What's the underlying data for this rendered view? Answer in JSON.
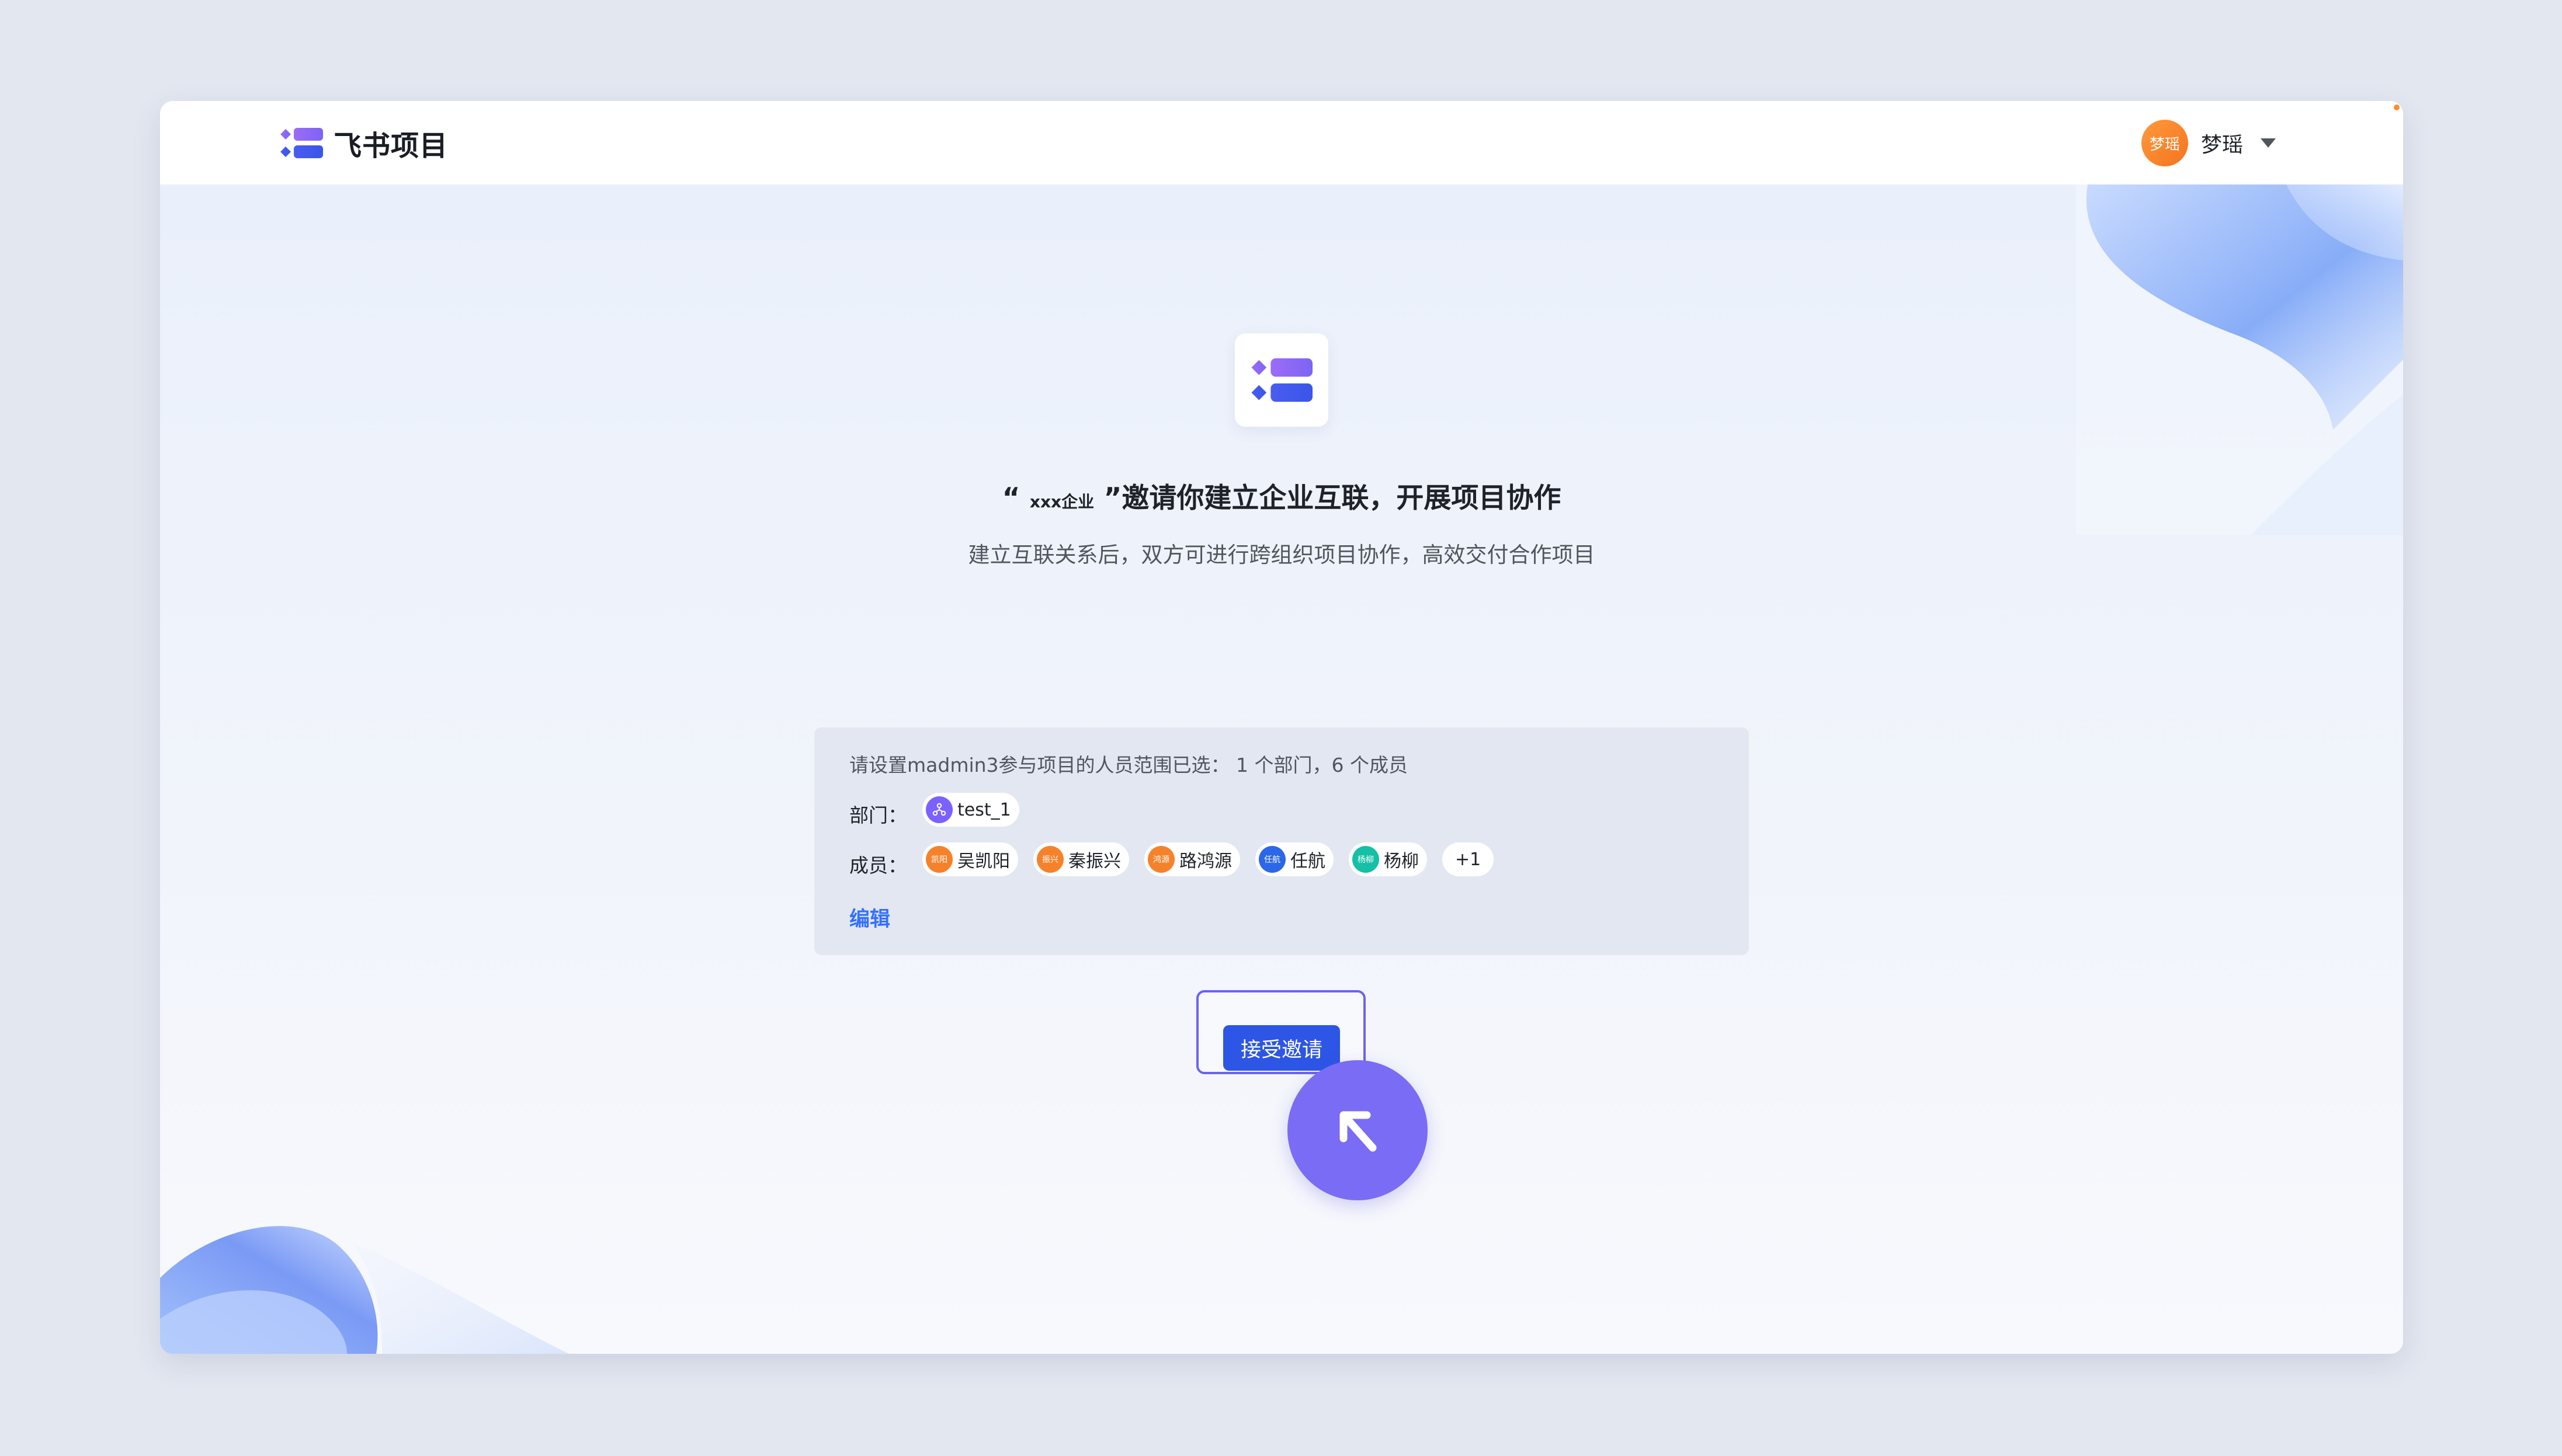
{
  "app": {
    "brand_name": "飞书项目"
  },
  "header": {
    "user_avatar_text": "梦瑶",
    "user_name": "梦瑶"
  },
  "invite": {
    "quote_open": "“",
    "org_name": "xxx企业",
    "quote_close": "”",
    "title_text": "邀请你建立企业互联，开展项目协作",
    "subtitle": "建立互联关系后，双方可进行跨组织项目协作，高效交付合作项目"
  },
  "range": {
    "hint": "请设置madmin3参与项目的人员范围已选：  1 个部门，6 个成员",
    "department_label": "部门：",
    "departments": [
      {
        "name": "test_1",
        "avatar_color": "#7b61ff"
      }
    ],
    "member_label": "成员：",
    "members": [
      {
        "name": "吴凯阳",
        "avatar_text": "凯阳",
        "avatar_color": "#f5822a"
      },
      {
        "name": "秦振兴",
        "avatar_text": "振兴",
        "avatar_color": "#f5822a"
      },
      {
        "name": "路鸿源",
        "avatar_text": "鸿源",
        "avatar_color": "#f5822a"
      },
      {
        "name": "任航",
        "avatar_text": "任航",
        "avatar_color": "#2b67e8"
      },
      {
        "name": "杨柳",
        "avatar_text": "杨柳",
        "avatar_color": "#14c0a6"
      }
    ],
    "more_count": "+1",
    "edit_label": "编辑"
  },
  "actions": {
    "accept_label": "接受邀请"
  },
  "colors": {
    "accent": "#2d55e6",
    "link": "#3370ff",
    "cursor_badge": "#7a6cf5",
    "highlight_border": "#6b63f0"
  },
  "icons": {
    "brand": "feishu-project-logo-icon",
    "caret": "caret-down-icon",
    "department": "org-tree-icon",
    "cursor": "arrow-up-left-icon"
  }
}
